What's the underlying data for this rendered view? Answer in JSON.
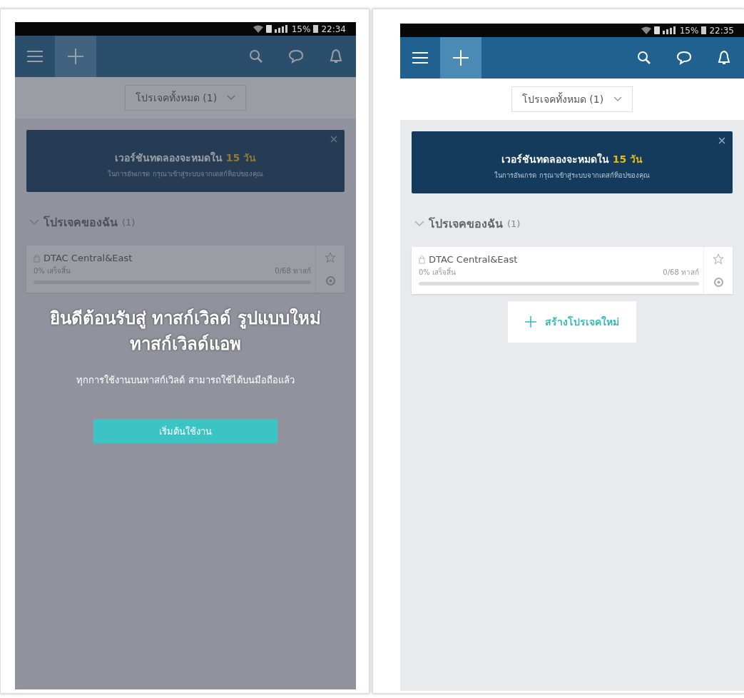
{
  "screens": [
    {
      "status_bar": {
        "battery": "15%",
        "time": "22:34"
      },
      "filter": "โปรเจคทั้งหมด (1)",
      "banner": {
        "title": "เวอร์ชันทดลองจะหมดใน",
        "highlight": "15 วัน",
        "subtitle": "ในการอัพเกรด กรุณาเข้าสู่ระบบจากเดสก์ท็อปของคุณ"
      },
      "section": {
        "title": "โปรเจคของฉัน",
        "count": "(1)",
        "expanded": true
      },
      "projects": [
        {
          "name": "DTAC Central&East",
          "progress": "0% เสร็จสิ้น",
          "tasks": "0/68 ทาสก์",
          "level": 0,
          "favorite": false
        }
      ],
      "modal": {
        "title": "ยินดีต้อนรับสู่ ทาสก์เวิลด์ รูปแบบใหม่",
        "title_2": "ทาสก์เวิลด์แอพ",
        "subtitle": "ทุกการใช้งานบนทาสก์เวิลด์ สามารถใช้ได้บนมือถือแล้ว",
        "button": "เริ่มต้นใช้งาน"
      }
    },
    {
      "status_bar": {
        "battery": "15%",
        "time": "22:35"
      },
      "filter": "โปรเจคทั้งหมด (1)",
      "banner": {
        "title": "เวอร์ชันทดลองจะหมดใน",
        "highlight": "15 วัน",
        "subtitle": "ในการอัพเกรด กรุณาเข้าสู่ระบบจากเดสก์ท็อปของคุณ"
      },
      "section": {
        "title": "โปรเจคของฉัน",
        "count": "(1)",
        "expanded": true
      },
      "projects": [
        {
          "name": "DTAC Central&East",
          "progress": "0% เสร็จสิ้น",
          "tasks": "0/68 ทาสก์",
          "level": 0,
          "favorite": false
        }
      ],
      "create_button": "สร้างโปรเจคใหม่"
    }
  ]
}
